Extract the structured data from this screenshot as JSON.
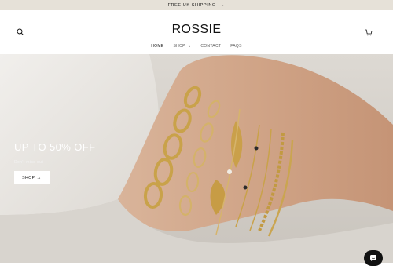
{
  "announcement": {
    "text": "FREE UK SHIPPING",
    "arrow": "→"
  },
  "header": {
    "logo": "ROSSIE",
    "search_icon": "search-icon",
    "cart_icon": "cart-icon"
  },
  "nav": {
    "items": [
      {
        "label": "HOME",
        "active": true
      },
      {
        "label": "SHOP",
        "dropdown": true,
        "chevron": "⌄"
      },
      {
        "label": "CONTACT"
      },
      {
        "label": "FAQS"
      }
    ]
  },
  "hero": {
    "title": "UP TO 50% OFF",
    "subtitle": "Don't miss out",
    "button_label": "SHOP",
    "button_arrow": "→"
  },
  "chat": {
    "icon": "chat-icon"
  },
  "colors": {
    "announcement_bg": "#e6e1d8",
    "gold": "#c9a24a",
    "chat_bg": "#111111"
  }
}
